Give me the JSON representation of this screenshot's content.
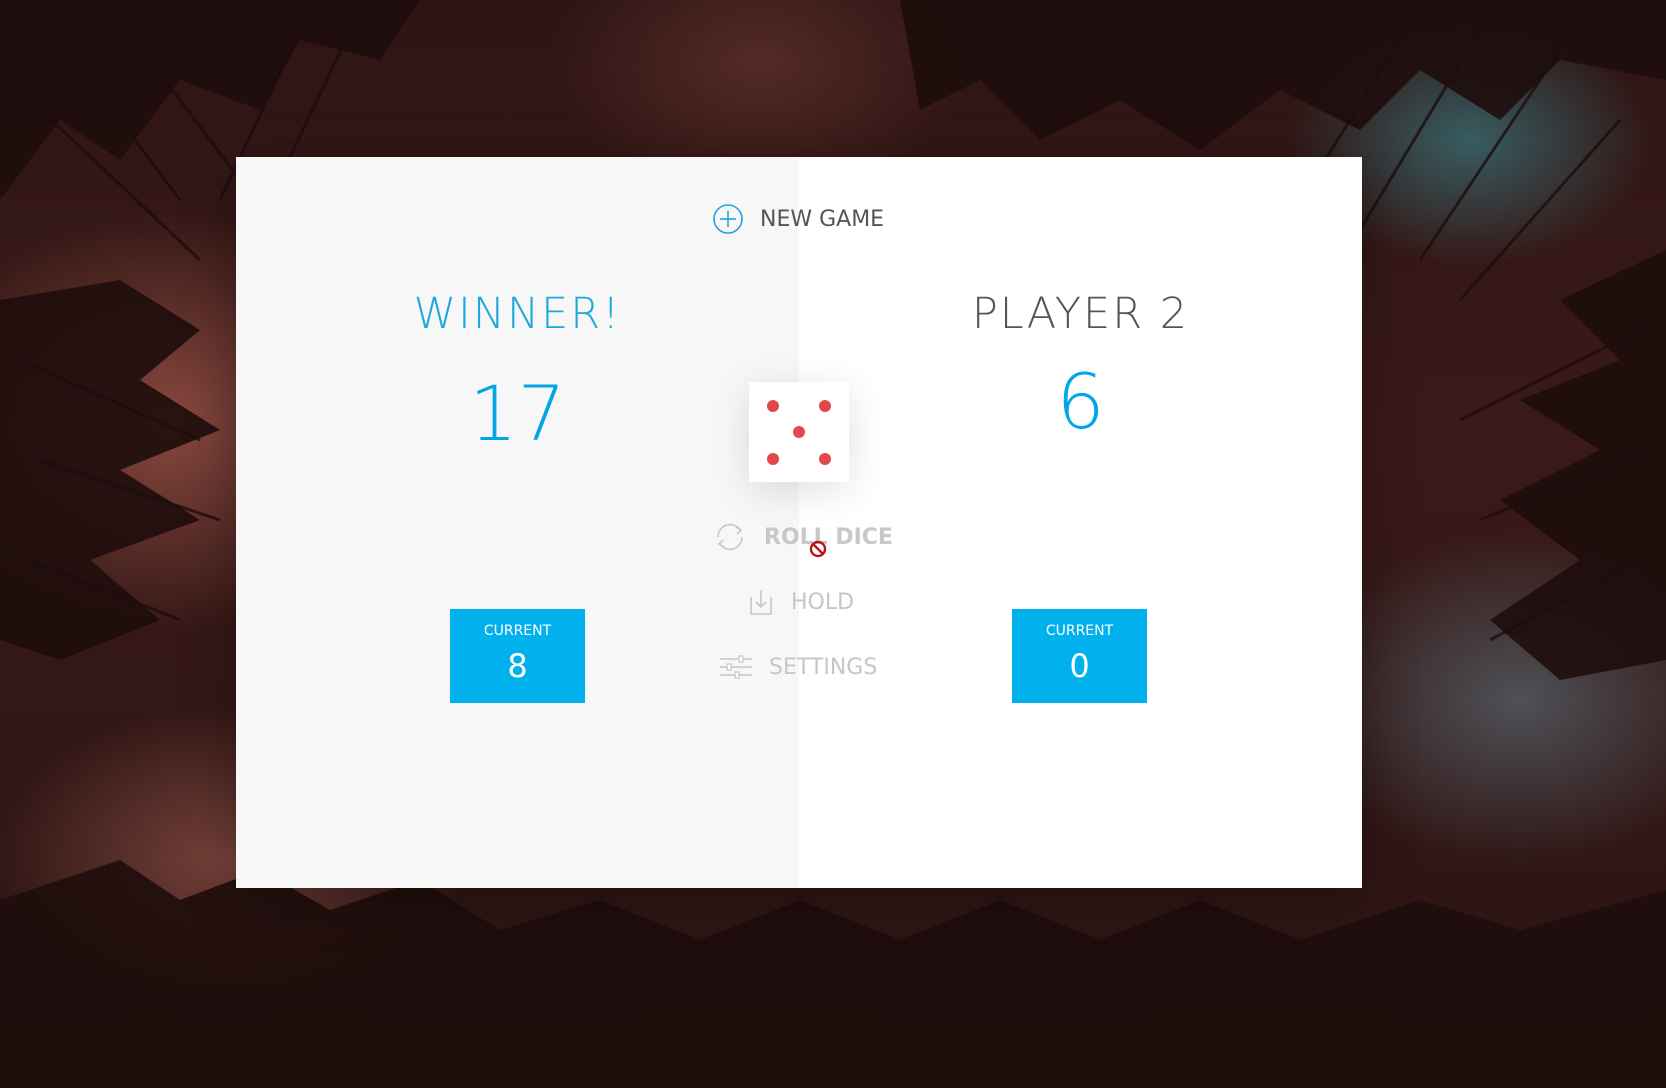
{
  "buttons": {
    "new_game": "NEW GAME",
    "roll_dice": "ROLL DICE",
    "hold": "HOLD",
    "settings": "SETTINGS"
  },
  "players": [
    {
      "name": "WINNER!",
      "score": "17",
      "current_label": "CURRENT",
      "current_value": "8"
    },
    {
      "name": "PLAYER 2",
      "score": "6",
      "current_label": "CURRENT",
      "current_value": "0"
    }
  ],
  "dice": {
    "value": 5,
    "pip_color": "#e2484b"
  },
  "colors": {
    "accent": "#00a6e6",
    "current_box": "#00b1ee",
    "winner": "#1fa7dc",
    "disabled_text": "#c8c8c8"
  },
  "icons": {
    "new_game": "plus-circle-icon",
    "roll_dice": "refresh-icon",
    "hold": "download-icon",
    "settings": "sliders-icon",
    "cursor": "not-allowed-cursor-icon"
  }
}
